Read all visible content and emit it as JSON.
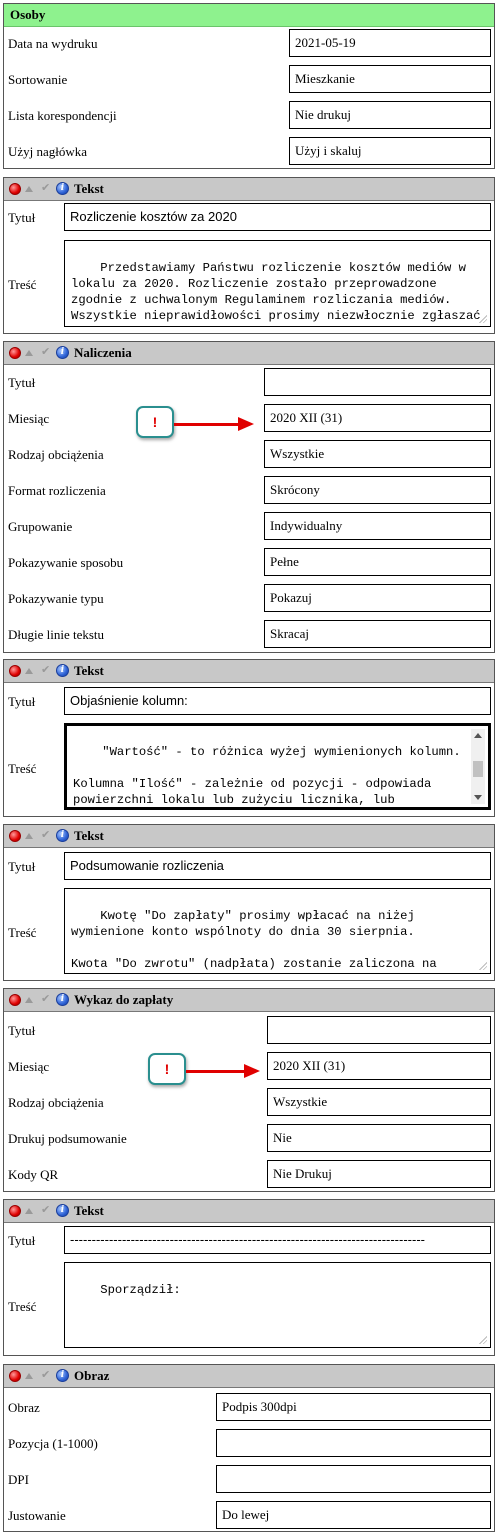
{
  "osoby": {
    "title": "Osoby",
    "rows": [
      {
        "label": "Data na wydruku",
        "value": "2021-05-19"
      },
      {
        "label": "Sortowanie",
        "value": "Mieszkanie"
      },
      {
        "label": "Lista korespondencji",
        "value": "Nie drukuj"
      },
      {
        "label": "Użyj nagłówka",
        "value": "Użyj i skaluj"
      }
    ]
  },
  "tekst1": {
    "title": "Tekst",
    "tytul_label": "Tytuł",
    "tytul_value": "Rozliczenie kosztów za 2020",
    "tresc_label": "Treść",
    "tresc_value": "Przedstawiamy Państwu rozliczenie kosztów mediów w lokalu za 2020. Rozliczenie zostało przeprowadzone zgodnie z uchwalonym Regulaminem rozliczania mediów. Wszystkie nieprawidłowości prosimy niezwłocznie zgłaszać do administracji wspólnoty."
  },
  "naliczenia": {
    "title": "Naliczenia",
    "rows": [
      {
        "label": "Tytuł",
        "value": ""
      },
      {
        "label": "Miesiąc",
        "value": "2020 XII (31)"
      },
      {
        "label": "Rodzaj obciążenia",
        "value": "Wszystkie"
      },
      {
        "label": "Format rozliczenia",
        "value": "Skrócony"
      },
      {
        "label": "Grupowanie",
        "value": "Indywidualny"
      },
      {
        "label": "Pokazywanie sposobu",
        "value": "Pełne"
      },
      {
        "label": "Pokazywanie typu",
        "value": "Pokazuj"
      },
      {
        "label": "Długie linie tekstu",
        "value": "Skracaj"
      }
    ],
    "callout": "!"
  },
  "tekst2": {
    "title": "Tekst",
    "tytul_label": "Tytuł",
    "tytul_value": "Objaśnienie kolumn:",
    "tresc_label": "Treść",
    "tresc_value": "\"Wartość\" - to różnica wyżej wymienionych kolumn.\n\nKolumna \"Ilość\" - zależnie od pozycji - odpowiada powierzchni lokalu lub zużyciu licznika, lub wyliczonemu udziałowi w rozliczeniu składnika."
  },
  "tekst3": {
    "title": "Tekst",
    "tytul_label": "Tytuł",
    "tytul_value": "Podsumowanie rozliczenia",
    "tresc_label": "Treść",
    "tresc_value": "Kwotę \"Do zapłaty\" prosimy wpłacać na niżej wymienione konto wspólnoty do dnia 30 sierpnia.\n\nKwota \"Do zwrotu\" (nadpłata) zostanie zaliczona na poczet opłat za przyszłe miesiące."
  },
  "wykaz": {
    "title": "Wykaz do zapłaty",
    "rows": [
      {
        "label": "Tytuł",
        "value": ""
      },
      {
        "label": "Miesiąc",
        "value": "2020 XII (31)"
      },
      {
        "label": "Rodzaj obciążenia",
        "value": "Wszystkie"
      },
      {
        "label": "Drukuj podsumowanie",
        "value": "Nie"
      },
      {
        "label": "Kody QR",
        "value": "Nie Drukuj"
      }
    ],
    "callout": "!"
  },
  "tekst4": {
    "title": "Tekst",
    "tytul_label": "Tytuł",
    "tytul_value": "----------------------------------------------------------------------------------",
    "tresc_label": "Treść",
    "tresc_value": "Sporządził:"
  },
  "obraz": {
    "title": "Obraz",
    "rows": [
      {
        "label": "Obraz",
        "value": "Podpis 300dpi"
      },
      {
        "label": "Pozycja (1-1000)",
        "value": ""
      },
      {
        "label": "DPI",
        "value": ""
      },
      {
        "label": "Justowanie",
        "value": "Do lewej"
      }
    ]
  }
}
